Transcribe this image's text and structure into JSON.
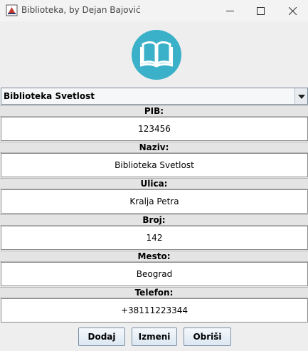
{
  "window": {
    "title": "Biblioteka, by Dejan Bajović",
    "controls": [
      "minimize-icon",
      "maximize-icon",
      "close-icon"
    ]
  },
  "logo": {
    "icon": "open-book-icon",
    "color": "#3ab1c8"
  },
  "library_select": {
    "selected": "Biblioteka Svetlost"
  },
  "fields": {
    "pib": {
      "label": "PIB:",
      "value": "123456"
    },
    "naziv": {
      "label": "Naziv:",
      "value": "Biblioteka Svetlost"
    },
    "ulica": {
      "label": "Ulica:",
      "value": "Kralja Petra"
    },
    "broj": {
      "label": "Broj:",
      "value": "142"
    },
    "mesto": {
      "label": "Mesto:",
      "value": "Beograd"
    },
    "telefon": {
      "label": "Telefon:",
      "value": "+38111223344"
    }
  },
  "buttons": {
    "dodaj": "Dodaj",
    "izmeni": "Izmeni",
    "obrisi": "Obriši"
  }
}
